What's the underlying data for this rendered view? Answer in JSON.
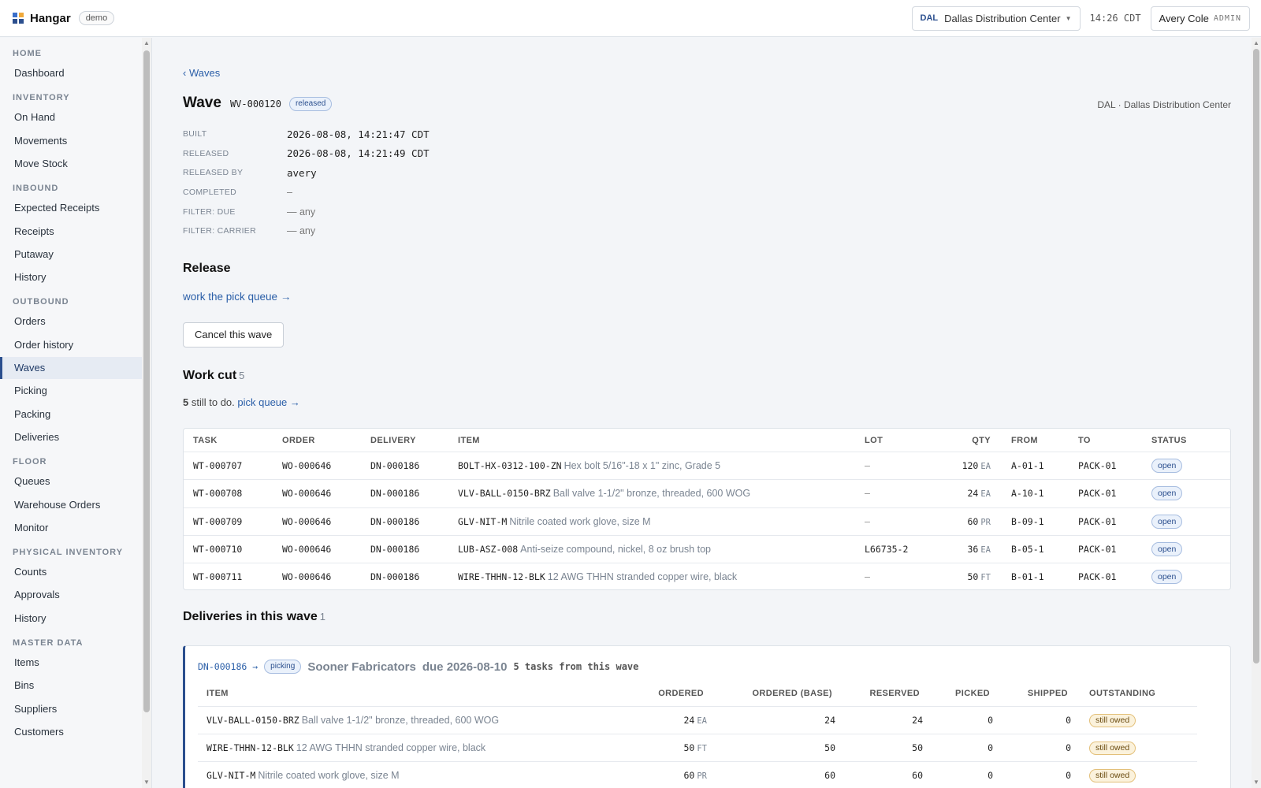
{
  "topbar": {
    "brand": "Hangar",
    "env_badge": "demo",
    "site_code": "DAL",
    "site_name": "Dallas Distribution Center",
    "clock": "14:26 CDT",
    "user_name": "Avery Cole",
    "user_role": "ADMIN"
  },
  "sidebar": {
    "sections": [
      {
        "label": "HOME",
        "items": [
          {
            "label": "Dashboard"
          }
        ]
      },
      {
        "label": "INVENTORY",
        "items": [
          {
            "label": "On Hand"
          },
          {
            "label": "Movements"
          },
          {
            "label": "Move Stock"
          }
        ]
      },
      {
        "label": "INBOUND",
        "items": [
          {
            "label": "Expected Receipts"
          },
          {
            "label": "Receipts"
          },
          {
            "label": "Putaway"
          },
          {
            "label": "History"
          }
        ]
      },
      {
        "label": "OUTBOUND",
        "items": [
          {
            "label": "Orders"
          },
          {
            "label": "Order history"
          },
          {
            "label": "Waves",
            "active": true
          },
          {
            "label": "Picking"
          },
          {
            "label": "Packing"
          },
          {
            "label": "Deliveries"
          }
        ]
      },
      {
        "label": "FLOOR",
        "items": [
          {
            "label": "Queues"
          },
          {
            "label": "Warehouse Orders"
          },
          {
            "label": "Monitor"
          }
        ]
      },
      {
        "label": "PHYSICAL INVENTORY",
        "items": [
          {
            "label": "Counts"
          },
          {
            "label": "Approvals"
          },
          {
            "label": "History"
          }
        ]
      },
      {
        "label": "MASTER DATA",
        "items": [
          {
            "label": "Items"
          },
          {
            "label": "Bins"
          },
          {
            "label": "Suppliers"
          },
          {
            "label": "Customers"
          }
        ]
      }
    ]
  },
  "page": {
    "back_link": "‹ Waves",
    "title": "Wave",
    "wave_id": "WV-000120",
    "status": "released",
    "site_label": "DAL · Dallas Distribution Center",
    "meta": [
      {
        "key": "BUILT",
        "value": "2026-08-08, 14:21:47 CDT",
        "mono": true
      },
      {
        "key": "RELEASED",
        "value": "2026-08-08, 14:21:49 CDT",
        "mono": true
      },
      {
        "key": "RELEASED BY",
        "value": "avery",
        "mono": true
      },
      {
        "key": "COMPLETED",
        "value": "–",
        "mono": false
      },
      {
        "key": "FILTER: DUE",
        "value": "—  any",
        "mono": false
      },
      {
        "key": "FILTER: CARRIER",
        "value": "— any",
        "mono": false
      }
    ],
    "release_heading": "Release",
    "pick_queue_link": "work the pick queue →",
    "cancel_button": "Cancel this wave",
    "work_cut_heading": "Work cut",
    "work_cut_count": "5",
    "still_count": "5",
    "still_text": " still to do. ",
    "still_link": "pick queue →"
  },
  "tasks": {
    "columns": [
      "TASK",
      "ORDER",
      "DELIVERY",
      "ITEM",
      "LOT",
      "QTY",
      "FROM",
      "TO",
      "STATUS"
    ],
    "rows": [
      {
        "task": "WT-000707",
        "order": "WO-000646",
        "delivery": "DN-000186",
        "sku": "BOLT-HX-0312-100-ZN",
        "desc": "Hex bolt 5/16\"-18 x 1\" zinc, Grade 5",
        "lot": "–",
        "qty": "120",
        "unit": "EA",
        "from": "A-01-1",
        "to": "PACK-01",
        "status": "open"
      },
      {
        "task": "WT-000708",
        "order": "WO-000646",
        "delivery": "DN-000186",
        "sku": "VLV-BALL-0150-BRZ",
        "desc": "Ball valve 1-1/2\" bronze, threaded, 600 WOG",
        "lot": "–",
        "qty": "24",
        "unit": "EA",
        "from": "A-10-1",
        "to": "PACK-01",
        "status": "open"
      },
      {
        "task": "WT-000709",
        "order": "WO-000646",
        "delivery": "DN-000186",
        "sku": "GLV-NIT-M",
        "desc": "Nitrile coated work glove, size M",
        "lot": "–",
        "qty": "60",
        "unit": "PR",
        "from": "B-09-1",
        "to": "PACK-01",
        "status": "open"
      },
      {
        "task": "WT-000710",
        "order": "WO-000646",
        "delivery": "DN-000186",
        "sku": "LUB-ASZ-008",
        "desc": "Anti-seize compound, nickel, 8 oz brush top",
        "lot": "L66735-2",
        "qty": "36",
        "unit": "EA",
        "from": "B-05-1",
        "to": "PACK-01",
        "status": "open"
      },
      {
        "task": "WT-000711",
        "order": "WO-000646",
        "delivery": "DN-000186",
        "sku": "WIRE-THHN-12-BLK",
        "desc": "12 AWG THHN stranded copper wire, black",
        "lot": "–",
        "qty": "50",
        "unit": "FT",
        "from": "B-01-1",
        "to": "PACK-01",
        "status": "open"
      }
    ]
  },
  "deliveries": {
    "heading": "Deliveries in this wave",
    "count": "1",
    "delivery_link": "DN-000186 →",
    "status": "picking",
    "customer": "Sooner Fabricators",
    "due": "due 2026-08-10",
    "task_count": "5 tasks from this wave",
    "columns": [
      "ITEM",
      "ORDERED",
      "ORDERED (BASE)",
      "RESERVED",
      "PICKED",
      "SHIPPED",
      "OUTSTANDING"
    ],
    "rows": [
      {
        "sku": "VLV-BALL-0150-BRZ",
        "desc": "Ball valve 1-1/2\" bronze, threaded, 600 WOG",
        "ordered": "24",
        "unit": "EA",
        "base": "24",
        "reserved": "24",
        "picked": "0",
        "shipped": "0",
        "outstanding": "still owed"
      },
      {
        "sku": "WIRE-THHN-12-BLK",
        "desc": "12 AWG THHN stranded copper wire, black",
        "ordered": "50",
        "unit": "FT",
        "base": "50",
        "reserved": "50",
        "picked": "0",
        "shipped": "0",
        "outstanding": "still owed"
      },
      {
        "sku": "GLV-NIT-M",
        "desc": "Nitrile coated work glove, size M",
        "ordered": "60",
        "unit": "PR",
        "base": "60",
        "reserved": "60",
        "picked": "0",
        "shipped": "0",
        "outstanding": "still owed"
      }
    ]
  },
  "colors": {
    "accent": "#2b4f8e",
    "link": "#2b5fa8",
    "warn_bg": "#fbf2dc"
  }
}
